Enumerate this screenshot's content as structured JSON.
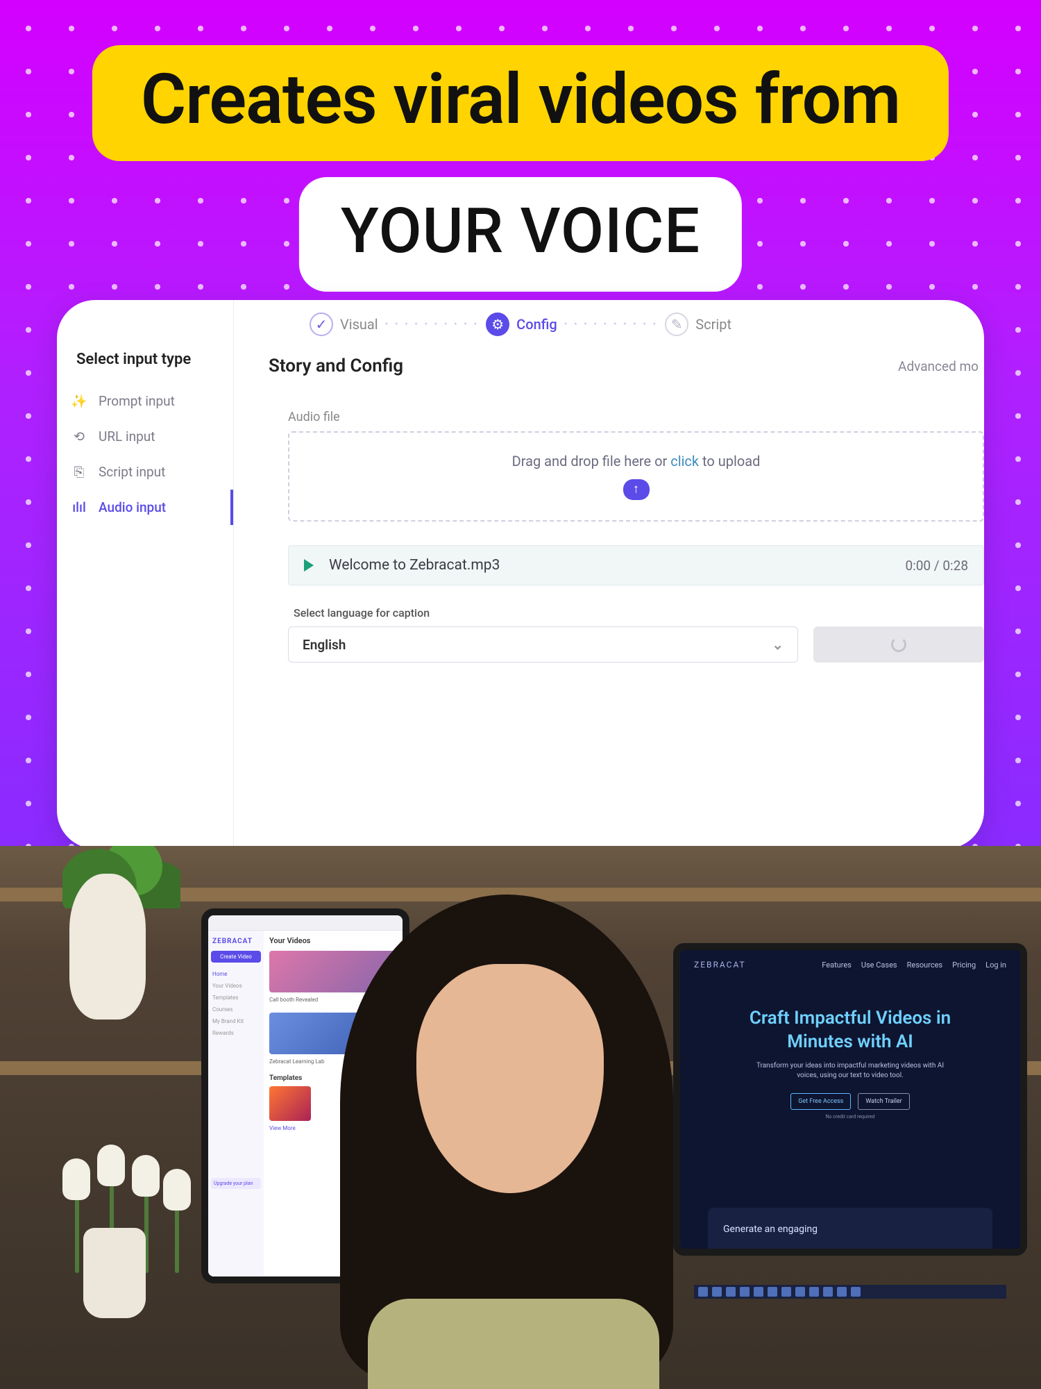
{
  "headline": {
    "line1": "Creates viral videos from",
    "line2": "YOUR VOICE"
  },
  "stepper": {
    "steps": [
      {
        "label": "Visual",
        "state": "done",
        "glyph": "✓"
      },
      {
        "label": "Config",
        "state": "active",
        "glyph": "⚙"
      },
      {
        "label": "Script",
        "state": "pending",
        "glyph": "✎"
      }
    ]
  },
  "sidebar": {
    "title": "Select input type",
    "items": [
      {
        "label": "Prompt input",
        "icon": "wand-icon",
        "active": false
      },
      {
        "label": "URL input",
        "icon": "link-icon",
        "active": false
      },
      {
        "label": "Script input",
        "icon": "script-icon",
        "active": false
      },
      {
        "label": "Audio input",
        "icon": "audio-wave-icon",
        "active": true
      }
    ]
  },
  "main": {
    "title": "Story and Config",
    "advanced_label": "Advanced mo",
    "audio_section_label": "Audio file",
    "dropzone": {
      "pre": "Drag and drop file here or ",
      "click": "click",
      "post": " to upload"
    },
    "file": {
      "name": "Welcome to Zebracat.mp3",
      "time": "0:00 / 0:28"
    },
    "language": {
      "label": "Select language for caption",
      "value": "English"
    }
  },
  "background": {
    "left_monitor": {
      "brand": "ZEBRACAT",
      "create_button": "Create Video",
      "nav": [
        "Home",
        "Your Videos",
        "Templates",
        "Courses",
        "My Brand Kit",
        "Rewards"
      ],
      "upgrade": "Upgrade your plan",
      "your_videos": "Your Videos",
      "caption1": "Call booth Revealed",
      "caption2": "Zebracat Learning Lab",
      "templates": "Templates",
      "view_more": "View More"
    },
    "right_monitor": {
      "brand": "ZEBRACAT",
      "nav": [
        "Features",
        "Use Cases",
        "Resources",
        "Pricing",
        "Log in"
      ],
      "hero_line1": "Craft Impactful Videos in",
      "hero_line2": "Minutes with AI",
      "sub": "Transform your ideas into impactful marketing videos with AI voices, using our text to video tool.",
      "btn1": "Get Free Access",
      "btn2": "Watch Trailer",
      "tiny": "No credit card required",
      "genbox": "Generate an engaging"
    }
  }
}
